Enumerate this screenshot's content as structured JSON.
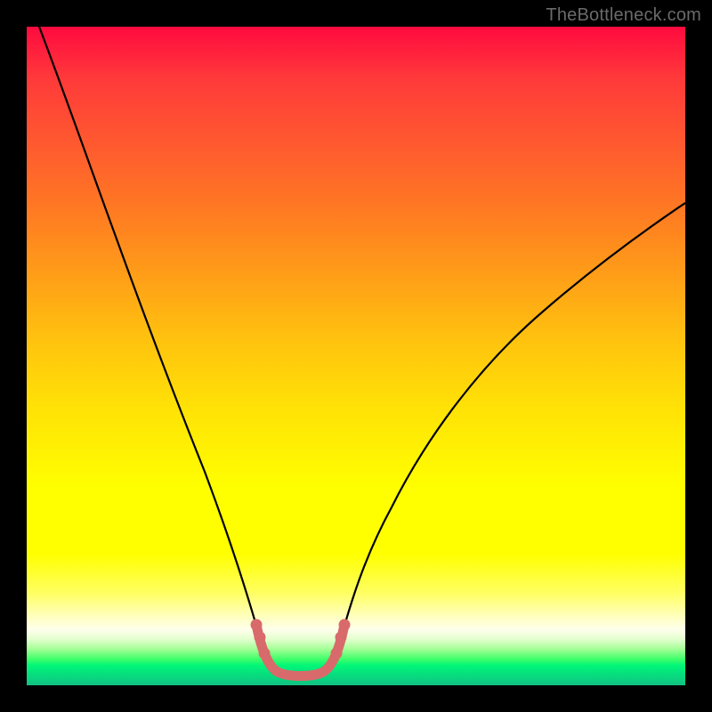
{
  "watermark": "TheBottleneck.com",
  "chart_data": {
    "type": "line",
    "title": "",
    "xlabel": "",
    "ylabel": "",
    "xlim": [
      0,
      100
    ],
    "ylim": [
      0,
      100
    ],
    "series": [
      {
        "name": "bottleneck-curve",
        "x": [
          2,
          5,
          10,
          15,
          20,
          25,
          28,
          30,
          32,
          34,
          35,
          37,
          40,
          43,
          45,
          47,
          50,
          55,
          60,
          65,
          70,
          75,
          80,
          85,
          90,
          95,
          100
        ],
        "values": [
          100,
          91,
          78,
          67,
          56,
          45,
          38,
          32,
          24,
          12,
          5,
          2,
          2,
          2,
          5,
          12,
          24,
          34,
          42,
          48,
          53,
          56.5,
          60,
          62.5,
          64.8,
          66.8,
          68.5
        ]
      }
    ],
    "highlight": {
      "name": "optimal-basin",
      "x": [
        34,
        35,
        36,
        37,
        40,
        43,
        44,
        45,
        46,
        47
      ],
      "values": [
        12,
        6,
        3,
        2,
        2,
        2,
        3,
        5,
        8,
        12
      ],
      "color": "#d96a6b"
    },
    "background": "red-yellow-green-vertical-gradient"
  }
}
